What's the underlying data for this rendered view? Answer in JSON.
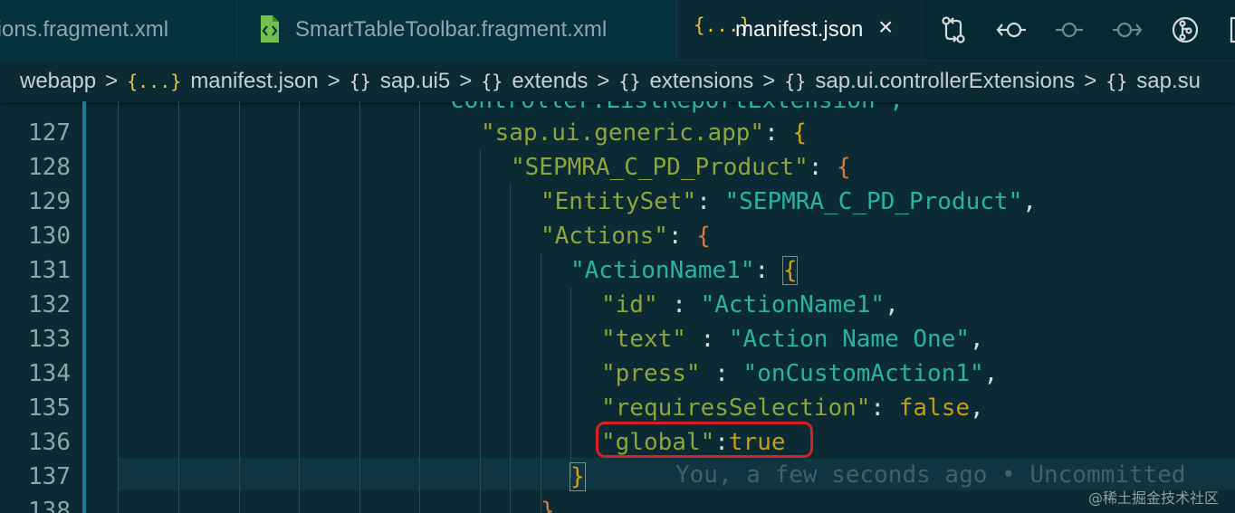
{
  "tabs": [
    {
      "label": "tions.fragment.xml",
      "active": false
    },
    {
      "label": "SmartTableToolbar.fragment.xml",
      "active": false,
      "icon": "xml-file-icon"
    },
    {
      "label": "manifest.json",
      "active": true,
      "icon": "json-braces-icon",
      "icon_text": "{...}",
      "close": "×"
    }
  ],
  "toolbar": {
    "icons": [
      "compare-changes-icon",
      "go-back-icon",
      "commit-icon",
      "go-forward-icon",
      "branch-graph-icon",
      "split-editor-icon"
    ]
  },
  "breadcrumb": {
    "items": [
      {
        "label": "webapp",
        "icon": ""
      },
      {
        "label": "manifest.json",
        "icon": "{...}"
      },
      {
        "label": "sap.ui5",
        "icon": "{}"
      },
      {
        "label": "extends",
        "icon": "{}"
      },
      {
        "label": "extensions",
        "icon": "{}"
      },
      {
        "label": "sap.ui.controllerExtensions",
        "icon": "{}"
      },
      {
        "label": "sap.su",
        "icon": "{}"
      }
    ],
    "separator": ">"
  },
  "editor": {
    "partial_top_line": "controller.ListReportExtension\",",
    "lines": [
      {
        "num": "127",
        "text": "\"sap.ui.generic.app\": {"
      },
      {
        "num": "128",
        "text": "\"SEPMRA_C_PD_Product\": {"
      },
      {
        "num": "129",
        "text": "\"EntitySet\": \"SEPMRA_C_PD_Product\","
      },
      {
        "num": "130",
        "text": "\"Actions\": {"
      },
      {
        "num": "131",
        "text": "\"ActionName1\": {"
      },
      {
        "num": "132",
        "text": "\"id\" : \"ActionName1\","
      },
      {
        "num": "133",
        "text": "\"text\" : \"Action Name One\","
      },
      {
        "num": "134",
        "text": "\"press\" : \"onCustomAction1\","
      },
      {
        "num": "135",
        "text": "\"requiresSelection\": false,"
      },
      {
        "num": "136",
        "text": "\"global\":true"
      },
      {
        "num": "137",
        "text": "}"
      },
      {
        "num": "138",
        "text": "},"
      }
    ],
    "blame": "You, a few seconds ago • Uncommitted",
    "highlighted": "\"global\":true"
  },
  "watermark": "@稀土掘金技术社区",
  "colors": {
    "background": "#0b2a33",
    "tab_inactive": "#06323d",
    "string": "#8fa53b",
    "key": "#2ab3a5",
    "boolean": "#c59d12",
    "highlight": "#d52128",
    "json_icon": "#e8c341"
  }
}
